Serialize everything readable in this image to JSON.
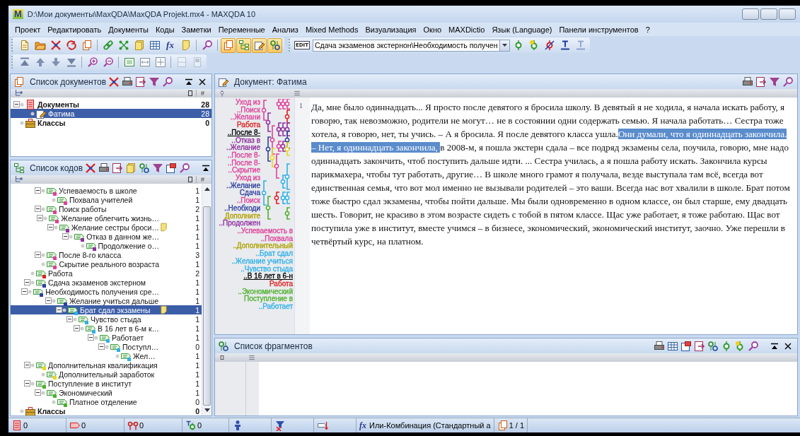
{
  "window": {
    "logo": "M",
    "title": "D:\\Мои документы\\MaxQDA\\MaxQDA Projekt.mx4 - MAXQDA 10"
  },
  "menu": [
    "Проект",
    "Редактировать",
    "Документы",
    "Коды",
    "Заметки",
    "Переменные",
    "Анализ",
    "Mixed Methods",
    "Визуализация",
    "Окно",
    "MAXDictio",
    "Язык (Language)",
    "Панели инструментов",
    "?"
  ],
  "toolbar_main": [
    {
      "kind": "document",
      "on": false
    },
    {
      "kind": "folder",
      "on": false
    },
    {
      "kind": "cross",
      "on": false
    },
    {
      "kind": "swap",
      "on": false
    },
    {
      "kind": "pages",
      "on": false
    },
    {
      "kind": "chain",
      "on": false
    },
    {
      "kind": "nodes",
      "on": false
    },
    {
      "kind": "notes",
      "on": false
    },
    {
      "kind": "table",
      "on": false
    },
    {
      "kind": "text",
      "label": "fx",
      "on": false
    },
    {
      "kind": "note",
      "on": false
    },
    {
      "kind": "search",
      "on": false
    },
    {
      "kind": "pages",
      "on": true
    },
    {
      "kind": "tree",
      "on": true
    },
    {
      "kind": "edit",
      "on": true
    },
    {
      "kind": "codes",
      "on": true
    }
  ],
  "toolbar_codes": {
    "badge": "EDIT",
    "combo_value": "Сдача экзаменов экстернон\\Необходимость получен",
    "buttons": [
      {
        "kind": "node",
        "disabled": false
      },
      {
        "kind": "nodestar",
        "disabled": false
      },
      {
        "kind": "nodex",
        "disabled": false
      },
      {
        "kind": "underline",
        "disabled": false
      },
      {
        "kind": "underline",
        "disabled": true
      }
    ]
  },
  "toolbar_view": [
    {
      "kind": "top",
      "disabled": false
    },
    {
      "kind": "up",
      "disabled": false
    },
    {
      "kind": "down",
      "disabled": false
    },
    {
      "kind": "bottom",
      "disabled": false
    },
    {
      "kind": "zoomin",
      "disabled": false
    },
    {
      "kind": "zoomout",
      "disabled": false
    },
    {
      "kind": "zoombox",
      "disabled": false
    },
    {
      "kind": "fitwidth",
      "disabled": false
    },
    {
      "kind": "fitpage",
      "disabled": false
    },
    {
      "kind": "split",
      "disabled": true
    },
    {
      "kind": "page",
      "disabled": true
    }
  ],
  "doc_list": {
    "title": "Список документов",
    "tools": [
      {
        "kind": "cross"
      },
      {
        "kind": "print"
      },
      {
        "kind": "export"
      },
      {
        "kind": "filter"
      },
      {
        "kind": "search"
      }
    ],
    "column_3": "#",
    "tree": [
      {
        "kind": "documents",
        "label": "Документы",
        "count": "28",
        "selected": false,
        "expanded": true,
        "children": [
          {
            "kind": "document",
            "label": "Фатима",
            "count": "28",
            "selected": true
          }
        ]
      },
      {
        "kind": "sets",
        "label": "Классы",
        "count": "0",
        "selected": false
      }
    ]
  },
  "code_list": {
    "title": "Список кодов",
    "tools": [
      {
        "kind": "cross"
      },
      {
        "kind": "print"
      },
      {
        "kind": "export"
      },
      {
        "kind": "notes"
      },
      {
        "kind": "codes"
      },
      {
        "kind": "filter"
      },
      {
        "kind": "import"
      },
      {
        "kind": "search"
      }
    ],
    "column_3": "#",
    "tree": [
      {
        "children": [
          {
            "children": [
              {
                "kind": "code",
                "label": "Успеваемость в школе",
                "count": "1",
                "color": "#e0409a",
                "memo": false,
                "selected": false,
                "expanded": true,
                "children": [
                  {
                    "kind": "code",
                    "label": "Похвала учителей",
                    "count": "1",
                    "color": "#e0409a",
                    "memo": false,
                    "selected": false
                  }
                ]
              },
              {
                "kind": "code",
                "label": "Поиск работы",
                "count": "2",
                "color": "#e0409a",
                "memo": false,
                "selected": false,
                "expanded": true,
                "children": [
                  {
                    "kind": "code",
                    "label": "Желание облегчить жизнь…",
                    "count": "1",
                    "color": "#e0409a",
                    "memo": false,
                    "selected": false,
                    "expanded": true,
                    "children": [
                      {
                        "kind": "code",
                        "label": "Желание сестры броси…",
                        "count": "1",
                        "color": "#9030a0",
                        "memo": true,
                        "selected": false,
                        "expanded": true,
                        "children": [
                          {
                            "kind": "code",
                            "label": "Отказ в данном же…",
                            "count": "1",
                            "color": "#9030a0",
                            "memo": false,
                            "selected": false,
                            "expanded": true,
                            "children": [
                              {
                                "kind": "code",
                                "label": "Продолжение о…",
                                "count": "1",
                                "color": "#9030a0",
                                "memo": false,
                                "selected": false
                              }
                            ]
                          }
                        ]
                      }
                    ]
                  }
                ]
              },
              {
                "kind": "code",
                "label": "После 8-го класса",
                "count": "3",
                "color": "#e0409a",
                "memo": false,
                "selected": false,
                "expanded": true,
                "children": [
                  {
                    "kind": "code",
                    "label": "Скрытие реального возраста",
                    "count": "1",
                    "color": "#e0409a",
                    "memo": false,
                    "selected": false
                  }
                ]
              }
            ]
          },
          {
            "kind": "code",
            "label": "Работа",
            "count": "2",
            "color": "#e02020",
            "memo": false,
            "selected": false
          },
          {
            "kind": "code",
            "label": "Сдача экзаменов экстерном",
            "count": "1",
            "color": "#3040a0",
            "memo": false,
            "selected": false,
            "expanded": true,
            "children": [
              {
                "kind": "code",
                "label": "Необходимость получения сре…",
                "count": "1",
                "color": "#3040a0",
                "memo": false,
                "selected": false,
                "expanded": true,
                "children": [
                  {
                    "kind": "code",
                    "label": "Желание учиться дальше",
                    "count": "1",
                    "color": "#3040a0",
                    "memo": false,
                    "selected": false,
                    "expanded": true,
                    "children": [
                      {
                        "kind": "code",
                        "label": "Брат сдал экзамены",
                        "count": "1",
                        "color": "#30b0e8",
                        "memo": true,
                        "selected": true,
                        "expanded": true,
                        "children": [
                          {
                            "kind": "code",
                            "label": "Чувство стыда",
                            "count": "1",
                            "color": "#30b0e8",
                            "memo": false,
                            "selected": false,
                            "expanded": true,
                            "children": [
                              {
                                "kind": "code",
                                "label": "В 16 лет в 6-м к…",
                                "count": "1",
                                "color": "#30b0e8",
                                "memo": false,
                                "selected": false,
                                "expanded": true,
                                "children": [
                                  {
                                    "kind": "code",
                                    "label": "Работает",
                                    "count": "1",
                                    "color": "#30b0e8",
                                    "memo": false,
                                    "selected": false,
                                    "expanded": true,
                                    "children": [
                                      {
                                        "kind": "code",
                                        "label": "Поступл…",
                                        "count": "0",
                                        "color": "#30b0e8",
                                        "memo": false,
                                        "selected": false,
                                        "expanded": true,
                                        "children": [
                                          {
                                            "kind": "code",
                                            "label": "Жел…",
                                            "count": "1",
                                            "color": "#30b0e8",
                                            "memo": false,
                                            "selected": false
                                          }
                                        ]
                                      }
                                    ]
                                  }
                                ]
                              }
                            ]
                          }
                        ]
                      }
                    ]
                  }
                ]
              }
            ]
          },
          {
            "kind": "code",
            "label": "Дополнительная квалификация",
            "count": "1",
            "color": "#e8d820",
            "memo": false,
            "selected": false,
            "expanded": true,
            "children": [
              {
                "kind": "code",
                "label": "Дополнительный заработок",
                "count": "1",
                "color": "#e8d820",
                "memo": false,
                "selected": false
              }
            ]
          },
          {
            "kind": "code",
            "label": "Поступление в институт",
            "count": "1",
            "color": "#50b030",
            "memo": false,
            "selected": false,
            "expanded": true,
            "children": [
              {
                "kind": "code",
                "label": "Экономический",
                "count": "1",
                "color": "#50b030",
                "memo": false,
                "selected": false,
                "expanded": true,
                "children": [
                  {
                    "kind": "code",
                    "label": "Платное отделение",
                    "count": "0",
                    "color": "#50b030",
                    "memo": false,
                    "selected": false
                  }
                ]
              }
            ]
          }
        ]
      },
      {
        "kind": "sets",
        "label": "Классы",
        "count": "0",
        "selected": false
      }
    ]
  },
  "document": {
    "title": "Документ: Фатима",
    "tools": [
      {
        "kind": "print"
      },
      {
        "kind": "export"
      },
      {
        "kind": "filter"
      },
      {
        "kind": "search"
      }
    ],
    "margin_labels": [
      {
        "text": "Уход из",
        "color": "#e0409a",
        "underlined": false
      },
      {
        "text": "..Поиск",
        "color": "#e0409a",
        "underlined": false
      },
      {
        "text": "..Желани",
        "color": "#e0409a",
        "underlined": false
      },
      {
        "text": "Работа",
        "color": "#e02020",
        "underlined": false
      },
      {
        "text": "..После 8-",
        "color": "#000000",
        "underlined": true
      },
      {
        "text": "..Отказ в",
        "color": "#9030a0",
        "underlined": false
      },
      {
        "text": "..Желание",
        "color": "#9030a0",
        "underlined": false
      },
      {
        "text": "..После 8-",
        "color": "#e0409a",
        "underlined": false
      },
      {
        "text": "..После 8-",
        "color": "#e0409a",
        "underlined": false
      },
      {
        "text": "..Скрытие",
        "color": "#e0409a",
        "underlined": false
      },
      {
        "text": "Уход из",
        "color": "#e0409a",
        "underlined": false
      },
      {
        "text": "..Желание",
        "color": "#3040a0",
        "underlined": false
      },
      {
        "text": "Сдача",
        "color": "#3040a0",
        "underlined": false
      },
      {
        "text": "..Поиск",
        "color": "#e0409a",
        "underlined": false
      },
      {
        "text": "..Необходи",
        "color": "#3040a0",
        "underlined": false
      },
      {
        "text": "Дополните",
        "color": "#b0a000",
        "underlined": false
      },
      {
        "text": "..Продолжен",
        "color": "#9030a0",
        "underlined": false
      },
      {
        "text": "..Успеваемость в",
        "color": "#e0409a",
        "underlined": false
      },
      {
        "text": "..Похвала",
        "color": "#e0409a",
        "underlined": false
      },
      {
        "text": "..Дополнительный",
        "color": "#b0a000",
        "underlined": false
      },
      {
        "text": "..Брат сдал",
        "color": "#30b0e8",
        "underlined": false
      },
      {
        "text": "..Желание учиться",
        "color": "#30b0e8",
        "underlined": false
      },
      {
        "text": "..Чувство стыда",
        "color": "#30b0e8",
        "underlined": false
      },
      {
        "text": "..В 16 лет в 6-н",
        "color": "#000000",
        "underlined": true
      },
      {
        "text": "Работа",
        "color": "#e02020",
        "underlined": false
      },
      {
        "text": "..Экономический",
        "color": "#50b030",
        "underlined": false
      },
      {
        "text": "Поступление в",
        "color": "#50b030",
        "underlined": false
      },
      {
        "text": "..Работает",
        "color": "#30b0e8",
        "underlined": false
      }
    ],
    "line_number": "1",
    "segments": [
      {
        "text": "Да, мне было одиннадцать... Я просто после девятого я бросила школу. В девятый я не ходила, я начала искать работу, я говорю, так невозможно, родители не могут… не в состоянии одни содержать семью. Я начала работать… Сестра тоже хотела, я говорю, нет, ты учись. – А я бросила. Я после девятого класса ушла.",
        "highlighted": false
      },
      {
        "text": "Они думали, что я одиннадцать закончила. – Нет, я одиннадцать закончила, ",
        "highlighted": true
      },
      {
        "text": "в 2008-м, я пошла экстерн сдала – все подряд экзамены села, поучила, говорю, мне надо одиннадцать закончить, чтоб поступить дальше идти. ... Сестра училась, а я пошла работу искать. Закончила курсы парикмахера, чтобы тут работать, другие… В школе много грамот я получала, везде выступала там всё, всегда вот единственная семья, что вот мол именно не вызывали родителей – это ваши. Всегда нас вот хвалили в школе. Брат потом тоже быстро сдал экзамены, чтобы пойти дальше. Мы были одновременно в одном классе, он был старше, ему двадцать шесть. Говорит, не красиво в этом возрасте сидеть с тобой в пятом классе. Щас уже работает, я тоже работаю. Щас вот поступила уже в институт, вместе учимся – в бизнесе, экономический, экономический институт, заочно. Уже перешли в четвёртый курс, на платном.",
        "highlighted": false
      }
    ]
  },
  "fragments": {
    "title": "Список фрагментов",
    "tools": [
      {
        "kind": "print"
      },
      {
        "kind": "table"
      },
      {
        "kind": "import"
      },
      {
        "kind": "export"
      },
      {
        "kind": "codes"
      },
      {
        "kind": "node"
      },
      {
        "kind": "nodestar"
      },
      {
        "kind": "search"
      }
    ]
  },
  "status_bar": [
    {
      "kind": "documents",
      "text": "0"
    },
    {
      "kind": "tag",
      "text": "0"
    },
    {
      "kind": "variables",
      "text": "0"
    },
    {
      "kind": "nodevar",
      "text": "0"
    },
    {
      "kind": "person"
    },
    {
      "kind": "filterx"
    },
    {
      "kind": "tagdown"
    },
    {
      "kind": "text",
      "glyph": "fx",
      "text": "Или-Комбинация (Стандартный а"
    },
    {
      "kind": "pages",
      "text": "1 / 1"
    }
  ]
}
